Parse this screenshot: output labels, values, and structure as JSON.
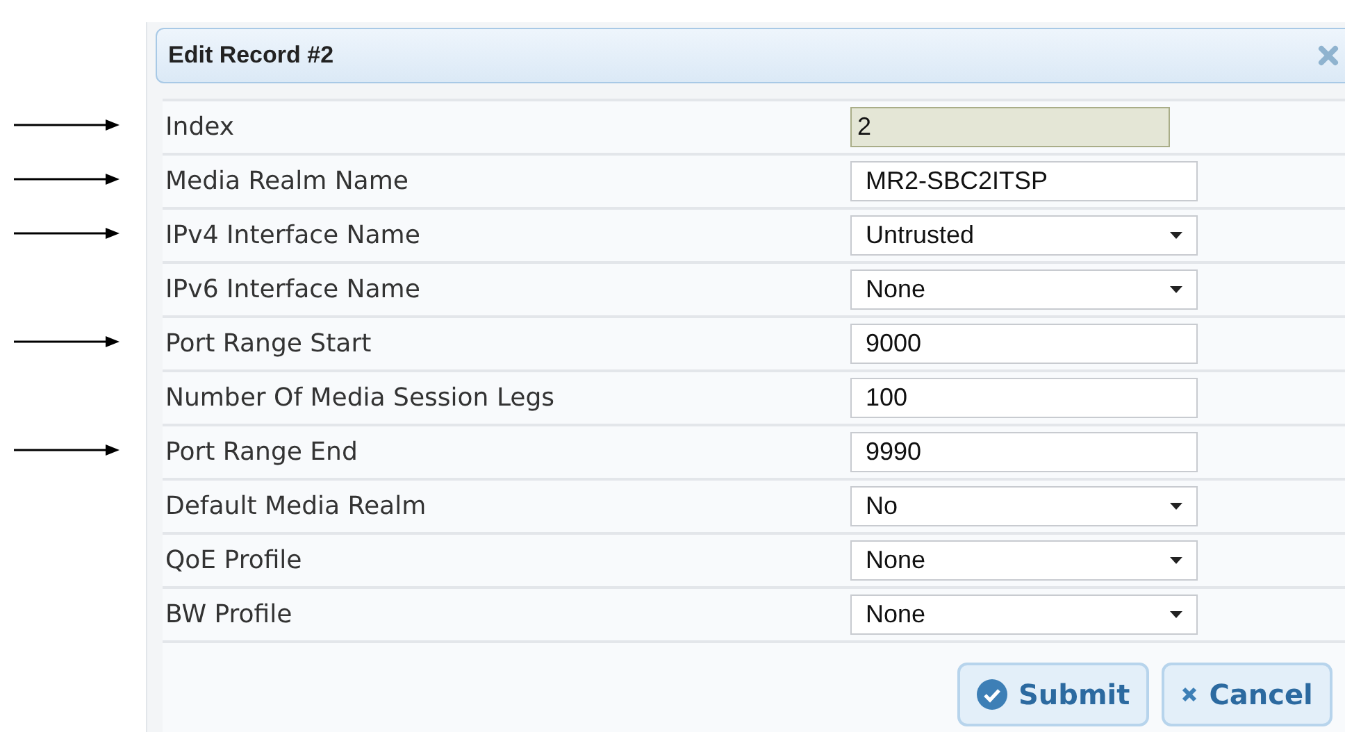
{
  "dialog": {
    "title": "Edit Record #2"
  },
  "rows": [
    {
      "label": "Index",
      "kind": "readonly",
      "value": "2",
      "pointed": true
    },
    {
      "label": "Media Realm Name",
      "kind": "text",
      "value": "MR2-SBC2ITSP",
      "pointed": true
    },
    {
      "label": "IPv4 Interface Name",
      "kind": "select",
      "value": "Untrusted",
      "pointed": true
    },
    {
      "label": "IPv6 Interface Name",
      "kind": "select",
      "value": "None",
      "pointed": false
    },
    {
      "label": "Port Range Start",
      "kind": "text",
      "value": "9000",
      "pointed": true
    },
    {
      "label": "Number Of Media Session Legs",
      "kind": "text",
      "value": "100",
      "pointed": false
    },
    {
      "label": "Port Range End",
      "kind": "text",
      "value": "9990",
      "pointed": true
    },
    {
      "label": "Default Media Realm",
      "kind": "select",
      "value": "No",
      "pointed": false
    },
    {
      "label": "QoE Profile",
      "kind": "select",
      "value": "None",
      "pointed": false
    },
    {
      "label": "BW Profile",
      "kind": "select",
      "value": "None",
      "pointed": false
    }
  ],
  "buttons": [
    {
      "kind": "submit",
      "label": "Submit"
    },
    {
      "kind": "cancel",
      "label": "Cancel"
    }
  ]
}
